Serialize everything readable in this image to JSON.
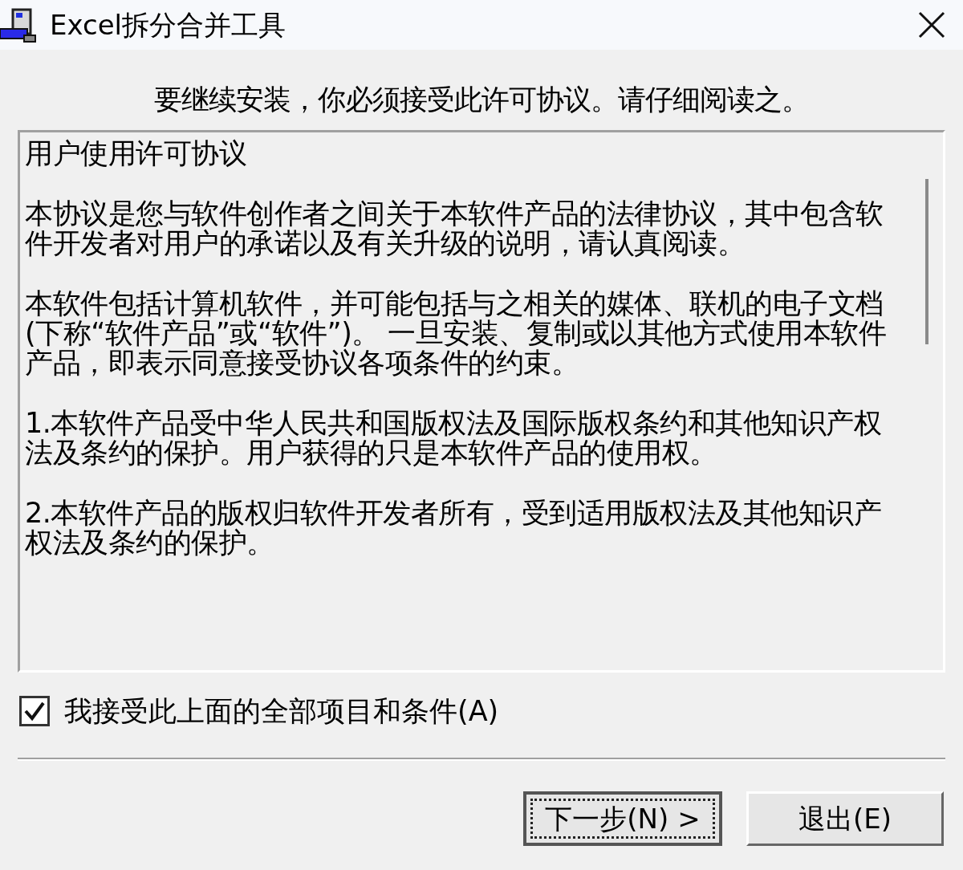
{
  "window": {
    "title": "Excel拆分合并工具"
  },
  "instruction": "要继续安装，你必须接受此许可协议。请仔细阅读之。",
  "license": {
    "paragraphs": [
      "用户使用许可协议",
      "本协议是您与软件创作者之间关于本软件产品的法律协议，其中包含软件开发者对用户的承诺以及有关升级的说明，请认真阅读。",
      "本软件包括计算机软件，并可能包括与之相关的媒体、联机的电子文档(下称“软件产品”或“软件”)。 一旦安装、复制或以其他方式使用本软件产品，即表示同意接受协议各项条件的约束。",
      "1.本软件产品受中华人民共和国版权法及国际版权条约和其他知识产权法及条约的保护。用户获得的只是本软件产品的使用权。",
      "2.本软件产品的版权归软件开发者所有，受到适用版权法及其他知识产权法及条约的保护。"
    ]
  },
  "accept_checkbox": {
    "label": "我接受此上面的全部项目和条件(A)",
    "checked": true
  },
  "buttons": [
    {
      "label": "下一步(N) >",
      "focused": true
    },
    {
      "label": "退出(E)",
      "focused": false
    }
  ]
}
